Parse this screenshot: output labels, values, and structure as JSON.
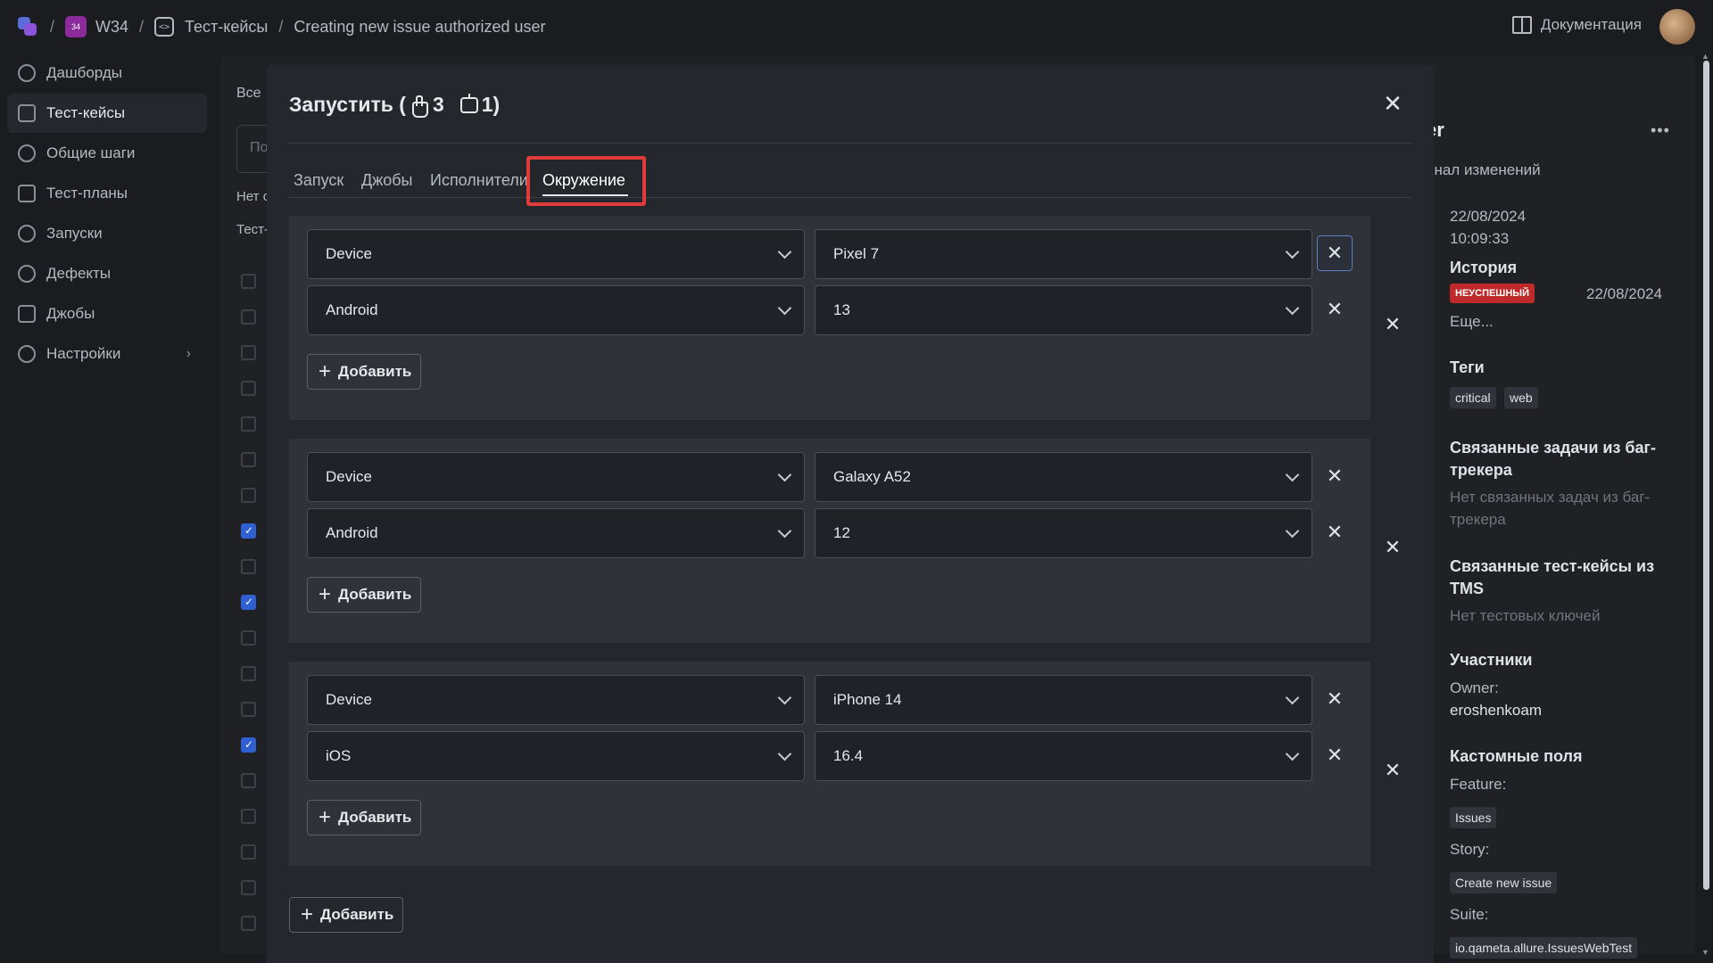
{
  "breadcrumb": {
    "project_badge": "34",
    "project": "W34",
    "section": "Тест-кейсы",
    "item": "Creating new issue authorized user",
    "docs": "Документация"
  },
  "sidebar": {
    "items": [
      {
        "label": "Дашборды"
      },
      {
        "label": "Тест-кейсы"
      },
      {
        "label": "Общие шаги"
      },
      {
        "label": "Тест-планы"
      },
      {
        "label": "Запуски"
      },
      {
        "label": "Дефекты"
      },
      {
        "label": "Джобы"
      },
      {
        "label": "Настройки"
      }
    ]
  },
  "background_list": {
    "filter_label": "Все",
    "search_placeholder": "По",
    "info1": "Нет с",
    "info2": "Тест-"
  },
  "detail": {
    "title_fragment": "er",
    "log_tab": "рнал изменений",
    "date": "22/08/2024",
    "time": "10:09:33",
    "history_head": "История",
    "history_status": "НЕУСПЕШНЫЙ",
    "history_date": "22/08/2024",
    "more": "Еще...",
    "tags_head": "Теги",
    "tags": [
      "critical",
      "web"
    ],
    "linked_issues_head": "Связанные задачи из баг-трекера",
    "linked_issues_empty": "Нет связанных задач из баг-трекера",
    "linked_tms_head": "Связанные тест-кейсы из TMS",
    "linked_tms_empty": "Нет тестовых ключей",
    "members_head": "Участники",
    "owner_label": "Owner:",
    "owner": "eroshenkoam",
    "custom_head": "Кастомные поля",
    "feature_label": "Feature:",
    "feature_tag": "Issues",
    "story_label": "Story:",
    "story_tag": "Create new issue",
    "suite_label": "Suite:",
    "suite_tag": "io.qameta.allure.IssuesWebTest"
  },
  "modal": {
    "title_prefix": "Запустить (",
    "manual_count": "3",
    "auto_count": "1)",
    "tabs": [
      "Запуск",
      "Джобы",
      "Исполнители",
      "Окружение"
    ],
    "add_label": "Добавить",
    "environments": [
      {
        "rows": [
          {
            "key": "Device",
            "value": "Pixel 7"
          },
          {
            "key": "Android",
            "value": "13"
          }
        ]
      },
      {
        "rows": [
          {
            "key": "Device",
            "value": "Galaxy A52"
          },
          {
            "key": "Android",
            "value": "12"
          }
        ]
      },
      {
        "rows": [
          {
            "key": "Device",
            "value": "iPhone 14"
          },
          {
            "key": "iOS",
            "value": "16.4"
          }
        ]
      }
    ]
  }
}
